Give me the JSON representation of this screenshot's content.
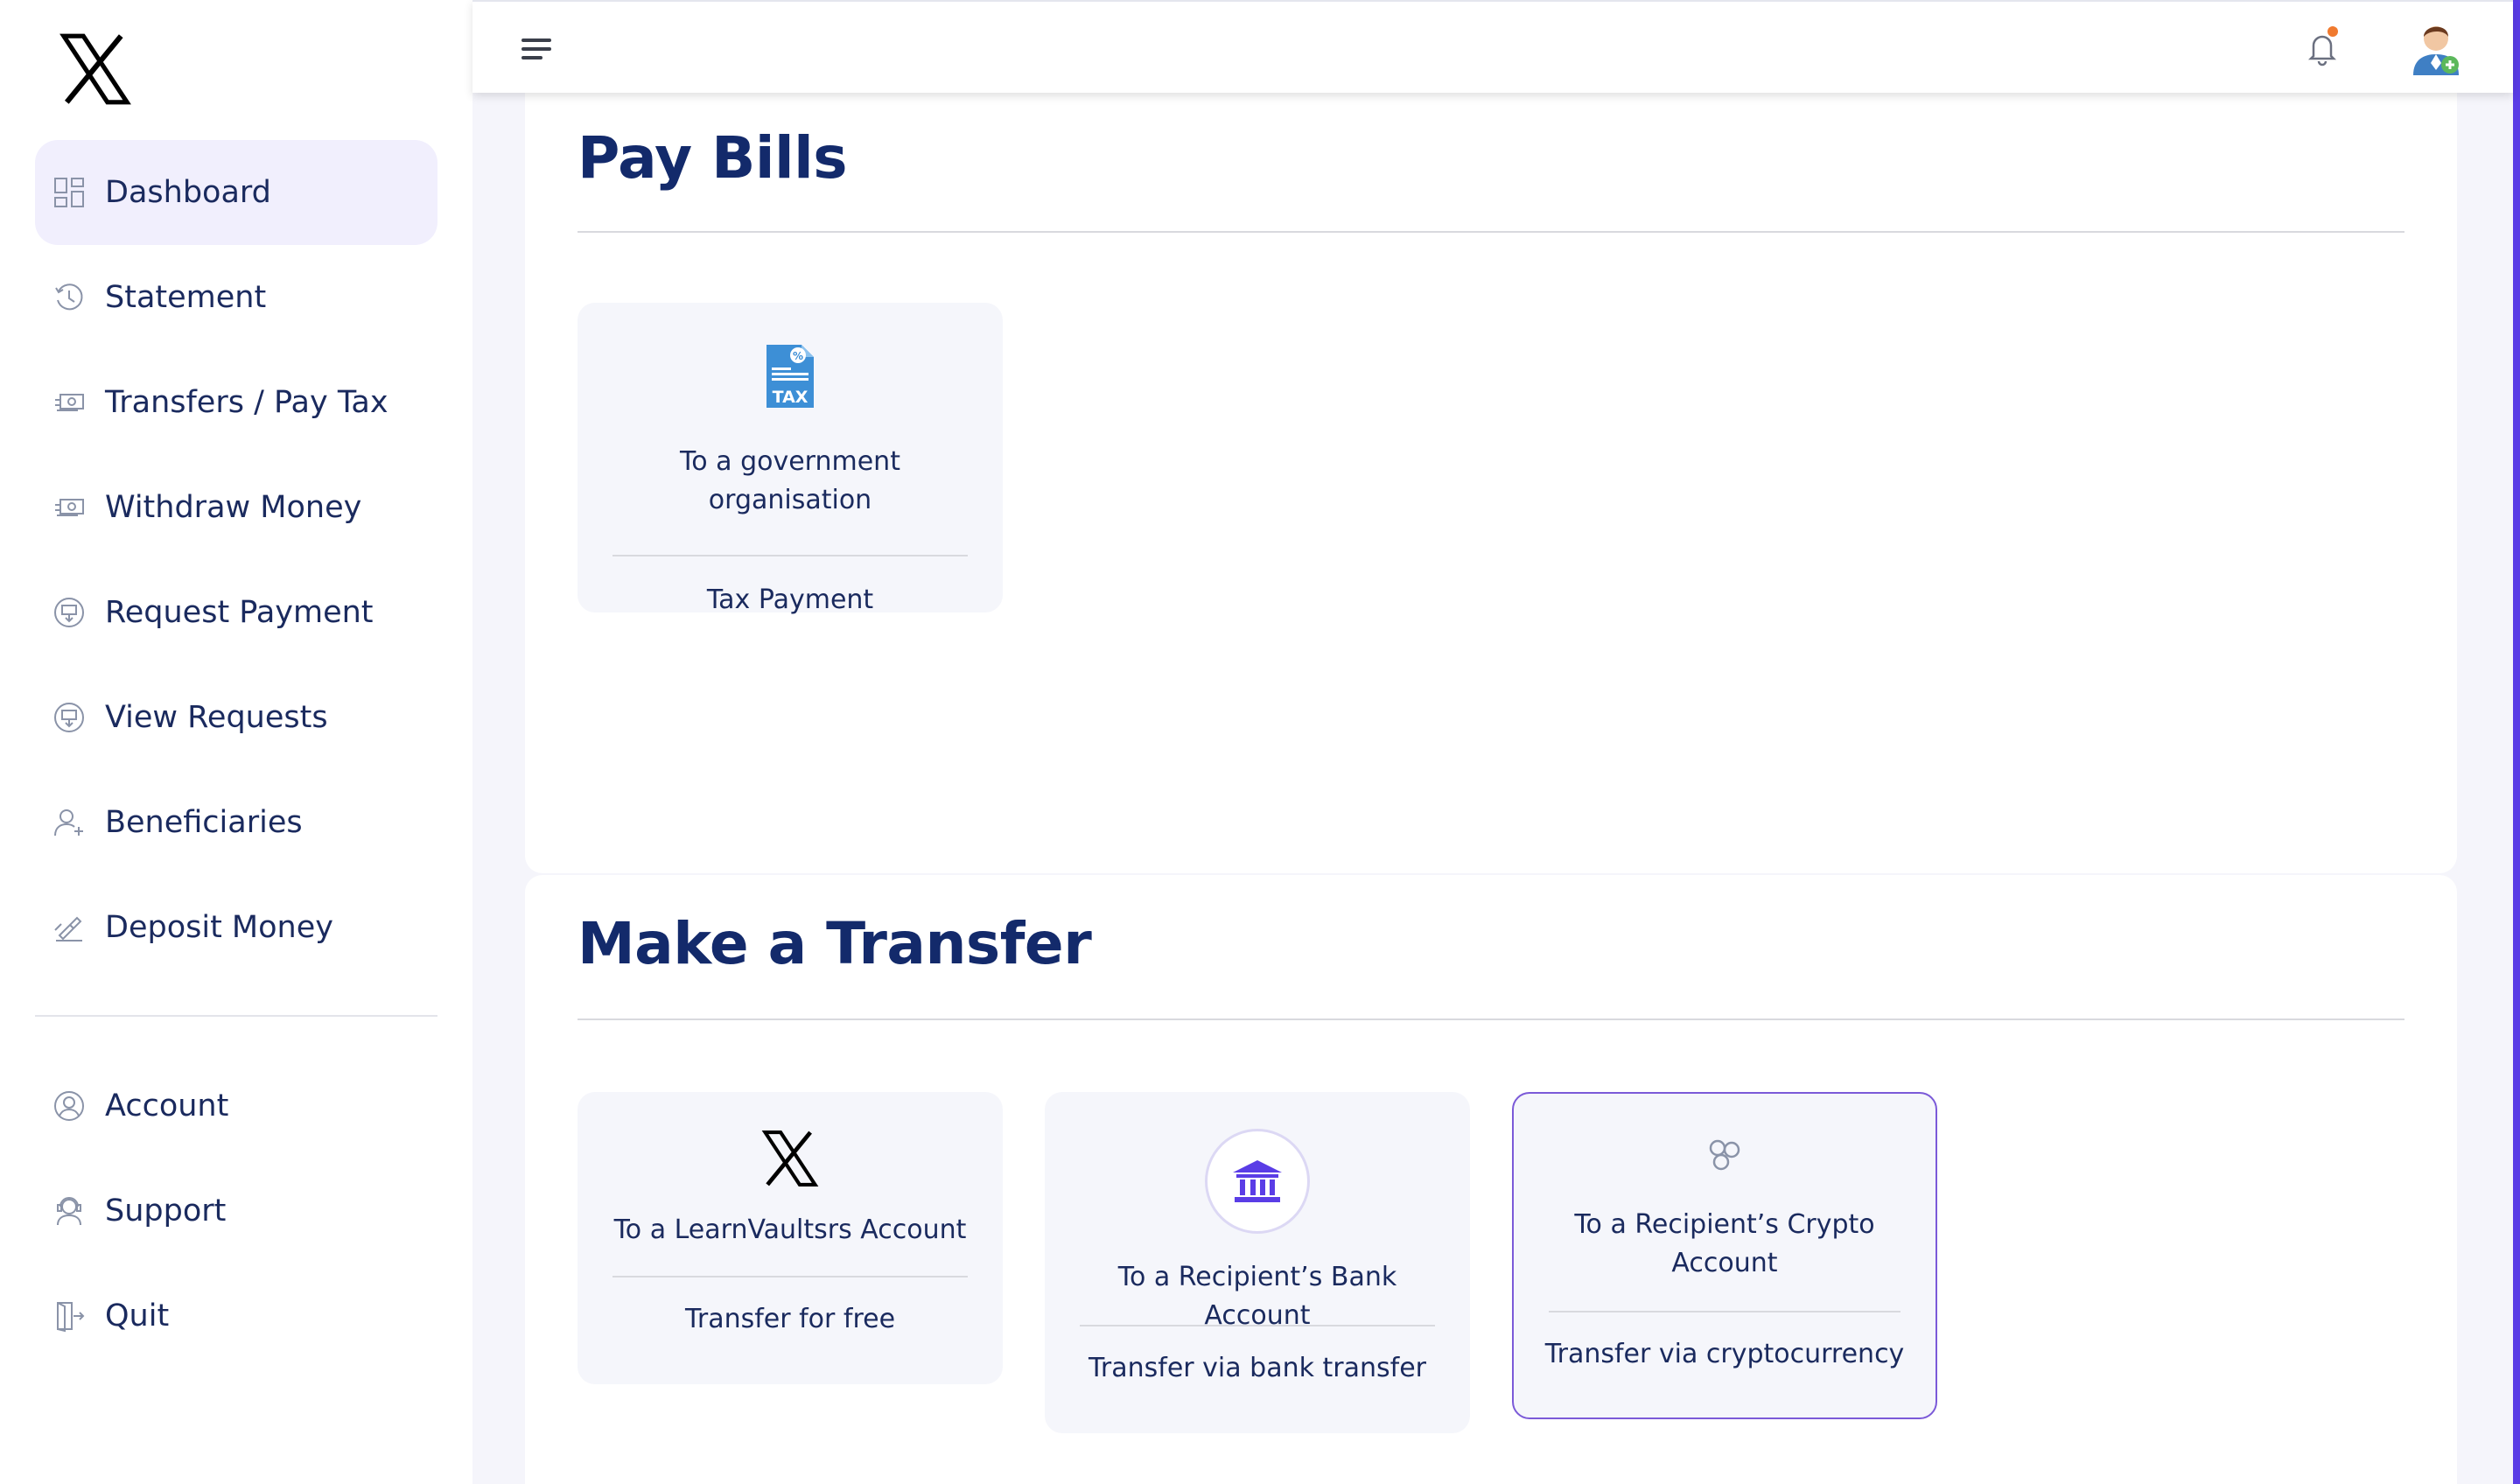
{
  "brand": {
    "logo_icon": "x-logo-icon"
  },
  "sidebar": {
    "items": [
      {
        "label": "Dashboard",
        "icon": "dashboard-icon",
        "active": true
      },
      {
        "label": "Statement",
        "icon": "history-icon"
      },
      {
        "label": "Transfers / Pay Tax",
        "icon": "money-transfer-icon"
      },
      {
        "label": "Withdraw Money",
        "icon": "money-withdraw-icon"
      },
      {
        "label": "Request Payment",
        "icon": "request-payment-icon"
      },
      {
        "label": "View Requests",
        "icon": "view-requests-icon"
      },
      {
        "label": "Beneficiaries",
        "icon": "user-add-icon"
      },
      {
        "label": "Deposit Money",
        "icon": "deposit-icon"
      }
    ],
    "secondary_items": [
      {
        "label": "Account",
        "icon": "user-circle-icon"
      },
      {
        "label": "Support",
        "icon": "support-agent-icon"
      },
      {
        "label": "Quit",
        "icon": "exit-door-icon"
      }
    ]
  },
  "topbar": {
    "menu_icon": "hamburger-menu-icon",
    "notification_icon": "bell-icon",
    "avatar_icon": "user-avatar-icon"
  },
  "pay_bills": {
    "title": "Pay Bills",
    "cards": [
      {
        "title": "To a government organisation",
        "subtitle": "Tax Payment",
        "icon": "tax-document-icon"
      }
    ]
  },
  "make_transfer": {
    "title": "Make a Transfer",
    "cards": [
      {
        "title": "To a LearnVaultsrs Account",
        "subtitle": "Transfer for free",
        "icon": "x-logo-icon"
      },
      {
        "title": "To a Recipient’s Bank Account",
        "subtitle": "Transfer via bank transfer",
        "icon": "bank-icon"
      },
      {
        "title": "To a Recipient’s Crypto Account",
        "subtitle": "Transfer via cryptocurrency",
        "icon": "crypto-coins-icon",
        "selected": true
      }
    ]
  },
  "colors": {
    "accent": "#5a3de6",
    "heading": "#132a6b",
    "active_nav_bg": "#f1effd",
    "card_bg": "#f5f6fb",
    "selected_border": "#7b5ad8",
    "tax_icon": "#3d8fd6",
    "notification_dot": "#f07a2f"
  }
}
